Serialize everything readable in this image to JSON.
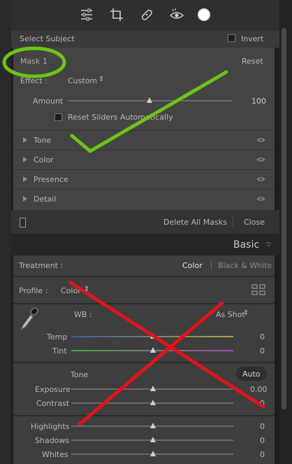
{
  "toolbar": {
    "tools": [
      "sliders-icon",
      "crop-icon",
      "healing-icon",
      "redeye-icon",
      "masking-icon"
    ]
  },
  "select_subject": {
    "label": "Select Subject",
    "invert_label": "Invert"
  },
  "mask": {
    "name": "Mask 1",
    "reset": "Reset",
    "effect_label": "Effect :",
    "effect_value": "Custom",
    "amount_label": "Amount",
    "amount_value": "100",
    "reset_sliders": "Reset Sliders Automatically",
    "sections": [
      "Tone",
      "Color",
      "Presence",
      "Detail"
    ]
  },
  "mask_footer": {
    "delete_all": "Delete All Masks",
    "close": "Close"
  },
  "basic": {
    "title": "Basic",
    "treatment_label": "Treatment :",
    "color": "Color",
    "bw": "Black & White",
    "profile_label": "Profile :",
    "profile_value": "Color",
    "wb_label": "WB :",
    "wb_value": "As Shot",
    "temp_label": "Temp",
    "temp_value": "0",
    "tint_label": "Tint",
    "tint_value": "0",
    "tone_label": "Tone",
    "auto": "Auto",
    "exposure_label": "Exposure",
    "exposure_value": "0.00",
    "contrast_label": "Contrast",
    "contrast_value": "0",
    "highlights_label": "Highlights",
    "highlights_value": "0",
    "shadows_label": "Shadows",
    "shadows_value": "0",
    "whites_label": "Whites",
    "whites_value": "0"
  },
  "colors": {
    "annotation_green": "#6cc417",
    "annotation_red": "#e0141b",
    "panel": "#444444",
    "text": "#b8b8b8"
  }
}
